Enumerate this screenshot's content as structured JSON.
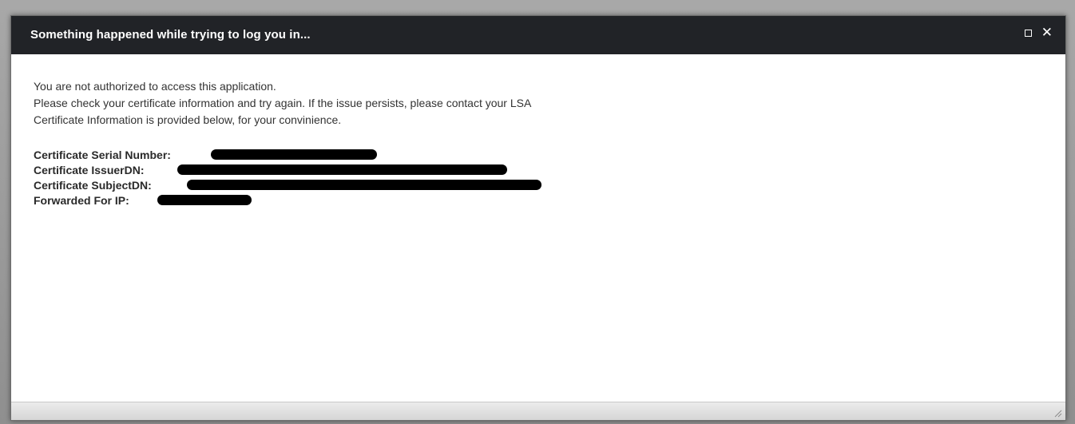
{
  "dialog": {
    "title": "Something happened while trying to log you in...",
    "controls": {
      "maximize_icon": "maximize-icon",
      "close_icon": "close-icon",
      "close_glyph": "✕"
    }
  },
  "message": {
    "lines": [
      "You are not authorized to access this application.",
      "Please check your certificate information and try again. If the issue persists, please contact your LSA",
      "Certificate Information is provided below, for your convinience."
    ]
  },
  "certificate": {
    "serial_number_label": "Certificate Serial Number:",
    "issuer_dn_label": "Certificate IssuerDN:",
    "subject_dn_label": "Certificate SubjectDN:",
    "forwarded_ip_label": "Forwarded For IP:",
    "values_redacted": true
  },
  "colors": {
    "titlebar": "#212327",
    "redaction": "#000000"
  }
}
